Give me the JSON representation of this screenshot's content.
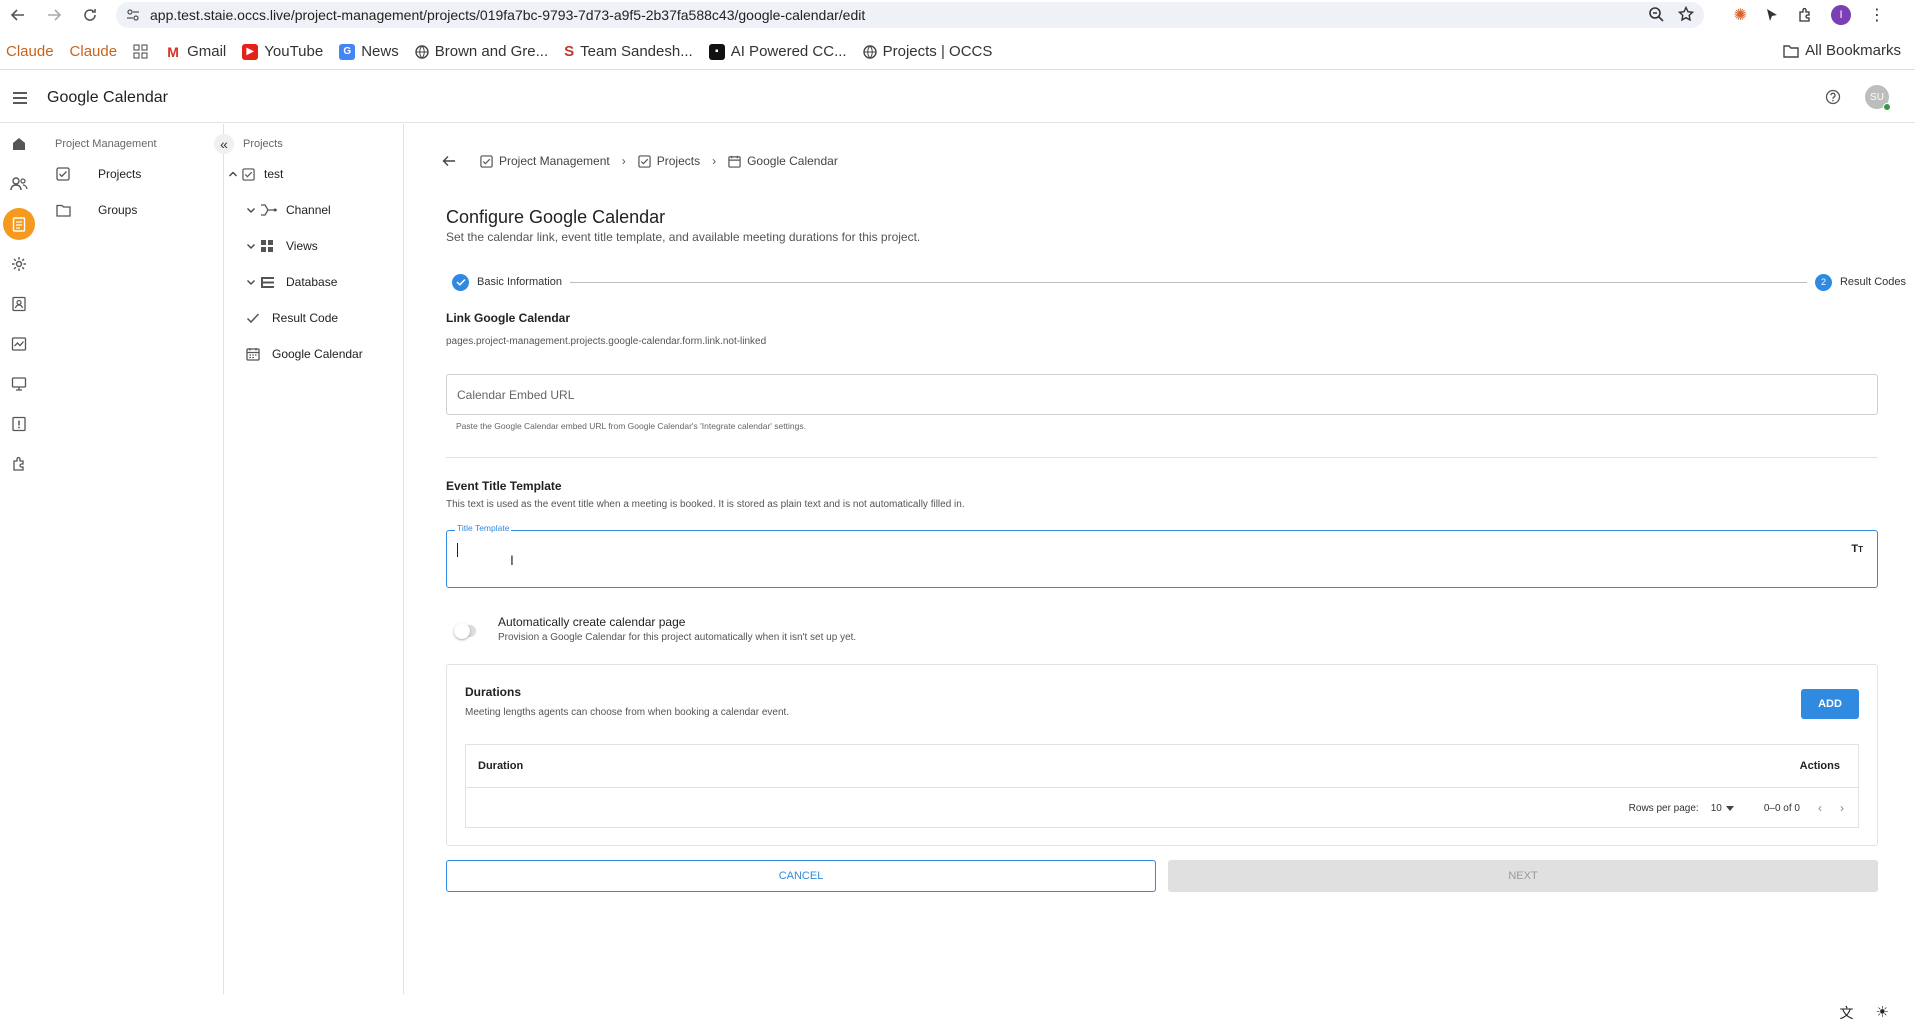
{
  "browser": {
    "url": "app.test.staie.occs.live/project-management/projects/019fa7bc-9793-7d73-a9f5-2b37fa588c43/google-calendar/edit",
    "profile_initial": "I",
    "bookmarks": [
      {
        "label": "Claude",
        "icon": "claude-logo"
      },
      {
        "label": "Claude",
        "icon": "claude-logo"
      },
      {
        "label": "",
        "icon": "apps-grid-icon"
      },
      {
        "label": "Gmail",
        "icon": "gmail-icon"
      },
      {
        "label": "YouTube",
        "icon": "youtube-icon"
      },
      {
        "label": "News",
        "icon": "news-icon"
      },
      {
        "label": "Brown and Gre...",
        "icon": "globe-icon"
      },
      {
        "label": "Team Sandesh...",
        "icon": "team-icon"
      },
      {
        "label": "AI Powered CC...",
        "icon": "ai-icon"
      },
      {
        "label": "Projects | OCCS",
        "icon": "globe-icon"
      }
    ],
    "all_bookmarks": "All Bookmarks"
  },
  "header": {
    "title": "Google Calendar",
    "avatar_initials": "SU"
  },
  "panel1": {
    "title": "Project Management",
    "items": [
      {
        "label": "Projects",
        "icon": "checkbox-icon"
      },
      {
        "label": "Groups",
        "icon": "folder-icon"
      }
    ]
  },
  "panel2": {
    "title": "Projects",
    "root": "test",
    "items": [
      {
        "label": "Channel",
        "icon": "channel-icon"
      },
      {
        "label": "Views",
        "icon": "grid-icon"
      },
      {
        "label": "Database",
        "icon": "database-icon"
      },
      {
        "label": "Result Code",
        "icon": "check-icon"
      },
      {
        "label": "Google Calendar",
        "icon": "calendar-icon"
      }
    ]
  },
  "breadcrumb": {
    "items": [
      "Project Management",
      "Projects",
      "Google Calendar"
    ]
  },
  "page": {
    "title": "Configure Google Calendar",
    "subtitle": "Set the calendar link, event title template, and available meeting durations for this project."
  },
  "stepper": {
    "step1": "Basic Information",
    "step2_number": "2",
    "step2": "Result Codes"
  },
  "link": {
    "title": "Link Google Calendar",
    "status": "pages.project-management.projects.google-calendar.form.link.not-linked",
    "input_placeholder": "Calendar Embed URL",
    "helper": "Paste the Google Calendar embed URL from Google Calendar's 'Integrate calendar' settings."
  },
  "event": {
    "title": "Event Title Template",
    "subtitle": "This text is used as the event title when a meeting is booked. It is stored as plain text and is not automatically filled in.",
    "input_label": "Title Template",
    "input_value": ""
  },
  "auto": {
    "label": "Automatically create calendar page",
    "sub": "Provision a Google Calendar for this project automatically when it isn't set up yet.",
    "enabled": false
  },
  "durations": {
    "title": "Durations",
    "subtitle": "Meeting lengths agents can choose from when booking a calendar event.",
    "add_label": "ADD",
    "col_duration": "Duration",
    "col_actions": "Actions",
    "rows_per_page_label": "Rows per page:",
    "rows_per_page": "10",
    "range": "0–0 of 0"
  },
  "actions": {
    "cancel": "CANCEL",
    "next": "NEXT"
  },
  "colors": {
    "primary": "#2f8ae0",
    "rail_active": "#f59a1c"
  }
}
